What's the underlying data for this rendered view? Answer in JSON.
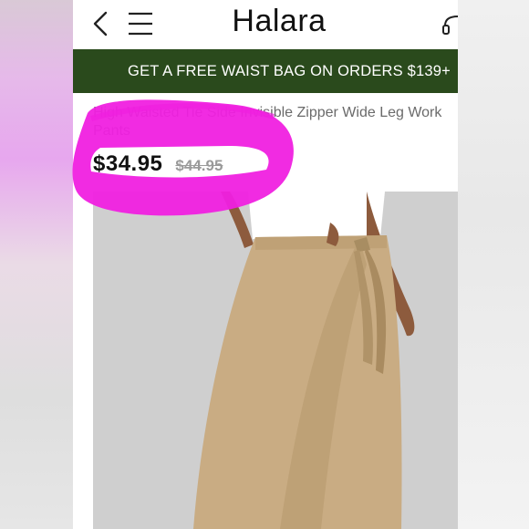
{
  "header": {
    "logo": "Halara",
    "back_icon": "chevron-left-icon",
    "menu_icon": "hamburger-menu-icon",
    "support_icon": "headset-icon"
  },
  "promo_banner": {
    "text": "GET A FREE WAIST BAG ON ORDERS $139+",
    "bg_color": "#2a4a1c"
  },
  "product": {
    "title": "High Waisted Tie Side Invisible Zipper Wide Leg Work Pants",
    "price": "$34.95",
    "original_price": "$44.95"
  },
  "colors": {
    "highlight": "#f020e0",
    "pants": "#c9ac83",
    "top": "#ffffff"
  }
}
